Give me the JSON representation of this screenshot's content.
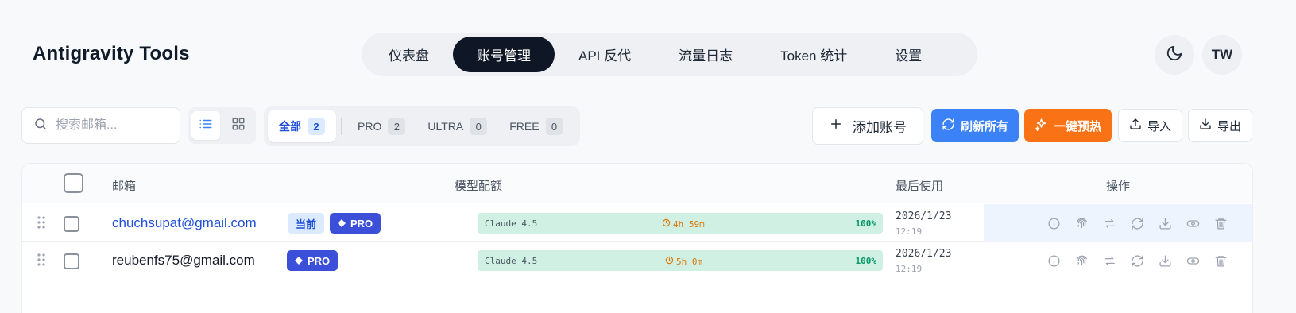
{
  "app": {
    "title": "Antigravity Tools"
  },
  "nav": {
    "tabs": [
      {
        "label": "仪表盘"
      },
      {
        "label": "账号管理"
      },
      {
        "label": "API 反代"
      },
      {
        "label": "流量日志"
      },
      {
        "label": "Token 统计"
      },
      {
        "label": "设置"
      }
    ],
    "active": "账号管理"
  },
  "header": {
    "theme_icon": "moon-icon",
    "avatar_initials": "TW"
  },
  "toolbar": {
    "search_placeholder": "搜索邮箱...",
    "view_modes": [
      "list-icon",
      "grid-icon"
    ],
    "filters": [
      {
        "label": "全部",
        "count": "2"
      },
      {
        "label": "PRO",
        "count": "2"
      },
      {
        "label": "ULTRA",
        "count": "0"
      },
      {
        "label": "FREE",
        "count": "0"
      }
    ],
    "add_label": "添加账号",
    "refresh_label": "刷新所有",
    "warmup_label": "一键预热",
    "import_label": "导入",
    "export_label": "导出"
  },
  "table": {
    "headers": {
      "email": "邮箱",
      "quota": "模型配额",
      "last_used": "最后使用",
      "actions": "操作"
    },
    "rows": [
      {
        "email": "chuchsupat@gmail.com",
        "current_badge": "当前",
        "plan": "PRO",
        "model": "Claude 4.5",
        "reset_in": "4h 59m",
        "quota_percent": "100%",
        "last_date": "2026/1/23",
        "last_time": "12:19"
      },
      {
        "email": "reubenfs75@gmail.com",
        "plan": "PRO",
        "model": "Claude 4.5",
        "reset_in": "5h 0m",
        "quota_percent": "100%",
        "last_date": "2026/1/23",
        "last_time": "12:19"
      }
    ],
    "action_icons": [
      "info-icon",
      "fingerprint-icon",
      "switch-icon",
      "refresh-icon",
      "download-icon",
      "toggle-icon",
      "trash-icon"
    ]
  },
  "colors": {
    "nav_active": "#0f1727",
    "refresh": "#3b82f6",
    "warmup": "#f97316",
    "pro_badge": "#3b4fd8",
    "quota_bar": "#d1f0e4",
    "quota_text": "#059669",
    "reset_text": "#d97706",
    "link": "#1d4ed8"
  }
}
